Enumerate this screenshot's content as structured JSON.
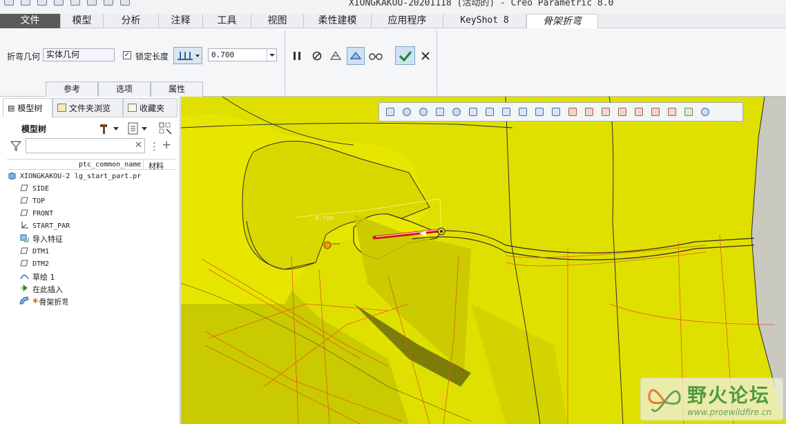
{
  "window": {
    "title": "XIONGKAKOU-20201118 (活动的) - Creo Parametric 8.0"
  },
  "tabs": [
    {
      "label": "文件"
    },
    {
      "label": "模型"
    },
    {
      "label": "分析"
    },
    {
      "label": "注释"
    },
    {
      "label": "工具"
    },
    {
      "label": "视图"
    },
    {
      "label": "柔性建模"
    },
    {
      "label": "应用程序"
    },
    {
      "label": "KeyShot 8"
    },
    {
      "label": "骨架折弯"
    }
  ],
  "ribbon": {
    "bend_geometry_label": "折弯几何",
    "bend_geometry_value": "实体几何",
    "lock_length_label": "锁定长度",
    "lock_length_checked": "✓",
    "value": "0.700",
    "panels": [
      "参考",
      "选项",
      "属性"
    ]
  },
  "left_panel": {
    "tabs": [
      "模型树",
      "文件夹浏览",
      "收藏夹"
    ],
    "tree_title": "模型树",
    "filter_placeholder": "",
    "columns": [
      "ptc_common_name",
      "材料"
    ],
    "rows": [
      {
        "icon": "part-icon",
        "label": "XIONGKAKOU-2",
        "common_name": "lg_start_part.pr"
      },
      {
        "icon": "datum-plane-icon",
        "label": "SIDE",
        "common_name": ""
      },
      {
        "icon": "datum-plane-icon",
        "label": "TOP",
        "common_name": ""
      },
      {
        "icon": "datum-plane-icon",
        "label": "FRONT",
        "common_name": ""
      },
      {
        "icon": "coordinate-system-icon",
        "label": "START_PAR",
        "common_name": ""
      },
      {
        "icon": "import-feature-icon",
        "label": "导入特征",
        "common_name": ""
      },
      {
        "icon": "datum-plane-icon",
        "label": "DTM1",
        "common_name": ""
      },
      {
        "icon": "datum-plane-icon",
        "label": "DTM2",
        "common_name": ""
      },
      {
        "icon": "sketch-icon",
        "label": "草绘 1",
        "common_name": ""
      },
      {
        "icon": "insert-here-icon",
        "label": "在此插入",
        "common_name": ""
      },
      {
        "icon": "spinal-bend-icon",
        "label": "骨架折弯",
        "common_name": ""
      }
    ]
  },
  "viewport": {
    "dimension_label": "0.700",
    "colors": {
      "model": "#e0e000",
      "edges": "#2a2a2a",
      "hidden": "#e05a18",
      "background": "#c9c9c0"
    }
  },
  "watermark": {
    "text": "野火论坛",
    "url": "www.proewildfire.cn"
  }
}
